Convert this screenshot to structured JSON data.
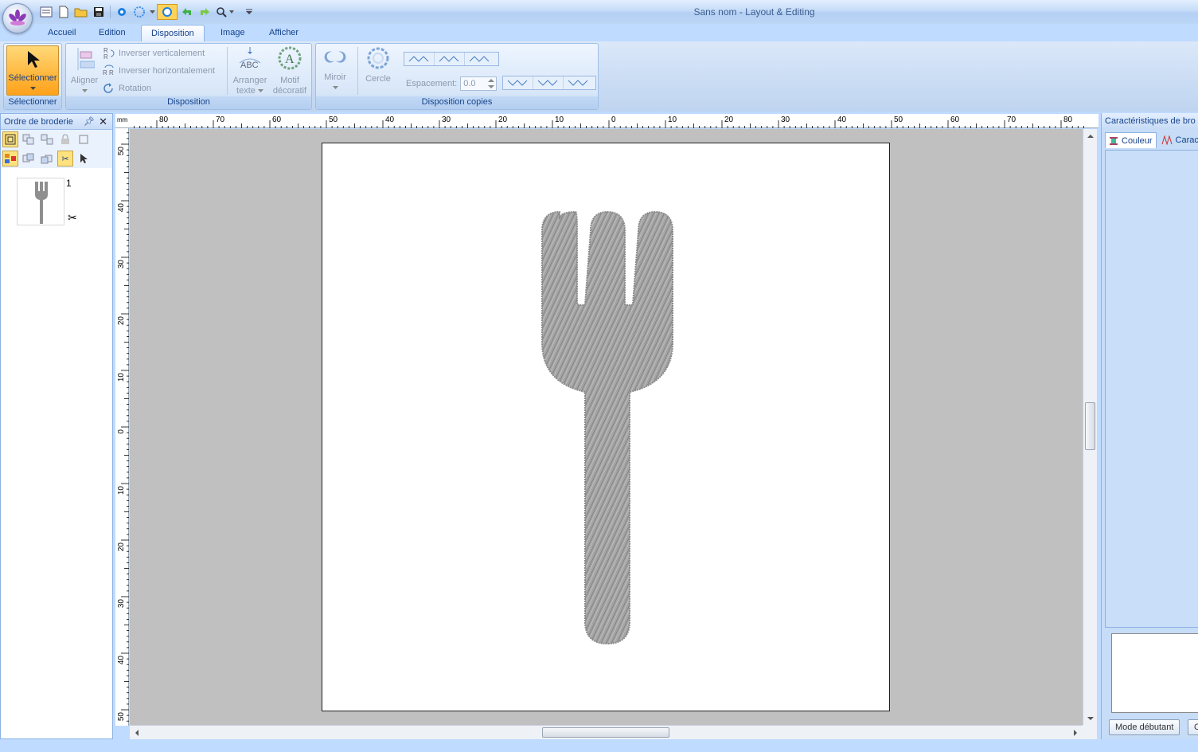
{
  "window": {
    "title": "Sans nom - Layout & Editing"
  },
  "quick_access": {
    "icons": [
      "layout-icon",
      "new-file-icon",
      "open-folder-icon",
      "save-icon",
      "point-icon",
      "circle-dots-icon",
      "dropdown-arrow-icon",
      "view-circle-icon",
      "undo-icon",
      "redo-icon",
      "zoom-icon",
      "customize-arrow-icon"
    ]
  },
  "tabs": [
    {
      "label": "Accueil"
    },
    {
      "label": "Edition"
    },
    {
      "label": "Disposition"
    },
    {
      "label": "Image"
    },
    {
      "label": "Afficher"
    }
  ],
  "ribbon": {
    "select_group": {
      "button_label": "Sélectionner",
      "group_label": "Sélectionner"
    },
    "disposition_group": {
      "align_label": "Aligner",
      "flip_vertical_label": "Inverser verticalement",
      "flip_horizontal_label": "Inverser horizontalement",
      "rotation_label": "Rotation",
      "arrange_text_line1": "Arranger",
      "arrange_text_line2": "texte",
      "decorative_motif_line1": "Motif",
      "decorative_motif_line2": "décoratif",
      "group_label": "Disposition"
    },
    "copies_group": {
      "mirror_label": "Miroir",
      "circle_label": "Cercle",
      "spacing_label": "Espacement:",
      "spacing_value": "0.0",
      "group_label": "Disposition copies"
    }
  },
  "left_panel": {
    "title": "Ordre de broderie",
    "item_number": "1"
  },
  "ruler": {
    "unit": "mm",
    "top_labels": [
      "80",
      "70",
      "60",
      "50",
      "40",
      "30",
      "20",
      "10",
      "0",
      "10",
      "20",
      "30",
      "40",
      "50",
      "60",
      "70",
      "80"
    ],
    "left_labels": [
      "50",
      "40",
      "30",
      "20",
      "10",
      "0",
      "10",
      "20",
      "30",
      "40",
      "50"
    ]
  },
  "right_panel": {
    "title": "Caractéristiques de bro",
    "tab_couleur": "Couleur",
    "tab_carac": "Carac",
    "mode_button": "Mode débutant",
    "second_button": "C"
  },
  "colors": {
    "ribbon_blue": "#bfdbff",
    "accent_orange": "#ffb942",
    "stitch_gray": "#9a9a9a"
  }
}
